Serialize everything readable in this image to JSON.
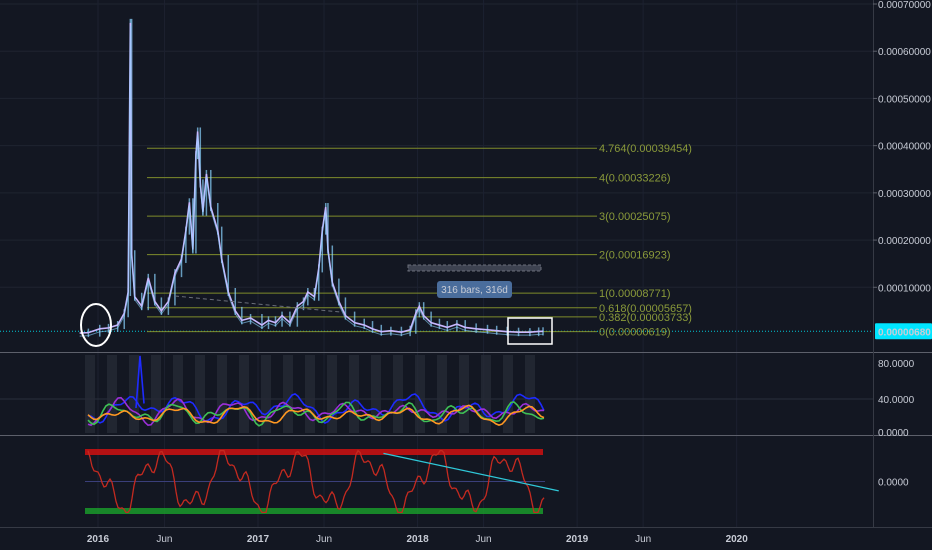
{
  "chart_data": [
    {
      "type": "line",
      "title": "",
      "price_axis": {
        "ticks": [
          "0.00070000",
          "0.00060000",
          "0.00050000",
          "0.00040000",
          "0.00030000",
          "0.00020000",
          "0.00010000"
        ],
        "tick_values": [
          0.0007,
          0.0006,
          0.0005,
          0.0004,
          0.0003,
          0.0002,
          0.0001
        ],
        "ylim": [
          0,
          0.0007
        ],
        "current_price_label": "0.00000680",
        "current_price": 6.8e-06
      },
      "x_ticks": [
        {
          "label": "2016",
          "date": "2016-01-01",
          "bold": true
        },
        {
          "label": "Jun",
          "date": "2016-06-01",
          "bold": false
        },
        {
          "label": "2017",
          "date": "2017-01-01",
          "bold": true
        },
        {
          "label": "Jun",
          "date": "2017-06-01",
          "bold": false
        },
        {
          "label": "2018",
          "date": "2018-01-01",
          "bold": true
        },
        {
          "label": "Jun",
          "date": "2018-06-01",
          "bold": false
        },
        {
          "label": "2019",
          "date": "2019-01-01",
          "bold": true
        },
        {
          "label": "Jun",
          "date": "2019-06-01",
          "bold": false
        },
        {
          "label": "2020",
          "date": "2020-01-01",
          "bold": true
        }
      ],
      "price_series": [
        [
          "2015-11-20",
          3e-06
        ],
        [
          "2015-12-10",
          4e-06
        ],
        [
          "2016-01-05",
          1.2e-05
        ],
        [
          "2016-01-25",
          1.4e-05
        ],
        [
          "2016-02-15",
          2e-05
        ],
        [
          "2016-03-01",
          4.5e-05
        ],
        [
          "2016-03-10",
          9e-05
        ],
        [
          "2016-03-15",
          0.00066
        ],
        [
          "2016-03-18",
          0.00017
        ],
        [
          "2016-03-25",
          8e-05
        ],
        [
          "2016-04-10",
          6e-05
        ],
        [
          "2016-04-25",
          0.00012
        ],
        [
          "2016-05-10",
          7e-05
        ],
        [
          "2016-05-25",
          5e-05
        ],
        [
          "2016-06-10",
          7e-05
        ],
        [
          "2016-06-25",
          0.00013
        ],
        [
          "2016-07-10",
          0.00016
        ],
        [
          "2016-07-20",
          0.00022
        ],
        [
          "2016-07-28",
          0.00028
        ],
        [
          "2016-08-05",
          0.00018
        ],
        [
          "2016-08-12",
          0.00038
        ],
        [
          "2016-08-16",
          0.00043
        ],
        [
          "2016-08-22",
          0.00032
        ],
        [
          "2016-08-28",
          0.00026
        ],
        [
          "2016-09-05",
          0.00034
        ],
        [
          "2016-09-15",
          0.00027
        ],
        [
          "2016-10-01",
          0.00022
        ],
        [
          "2016-10-10",
          0.00016
        ],
        [
          "2016-10-25",
          9e-05
        ],
        [
          "2016-11-10",
          5e-05
        ],
        [
          "2016-11-25",
          3e-05
        ],
        [
          "2016-12-15",
          3.5e-05
        ],
        [
          "2017-01-10",
          2e-05
        ],
        [
          "2017-01-25",
          3e-05
        ],
        [
          "2017-02-10",
          2.5e-05
        ],
        [
          "2017-02-25",
          4e-05
        ],
        [
          "2017-03-15",
          2.5e-05
        ],
        [
          "2017-04-01",
          6e-05
        ],
        [
          "2017-04-15",
          7e-05
        ],
        [
          "2017-04-25",
          9e-05
        ],
        [
          "2017-05-10",
          8e-05
        ],
        [
          "2017-05-20",
          0.00014
        ],
        [
          "2017-05-28",
          0.00022
        ],
        [
          "2017-06-05",
          0.00027
        ],
        [
          "2017-06-10",
          0.00018
        ],
        [
          "2017-06-20",
          0.00011
        ],
        [
          "2017-07-05",
          7e-05
        ],
        [
          "2017-07-20",
          4e-05
        ],
        [
          "2017-08-10",
          2.5e-05
        ],
        [
          "2017-09-01",
          2e-05
        ],
        [
          "2017-09-20",
          1.2e-05
        ],
        [
          "2017-10-10",
          6e-06
        ],
        [
          "2017-11-01",
          8e-06
        ],
        [
          "2017-11-25",
          5e-06
        ],
        [
          "2017-12-15",
          1e-05
        ],
        [
          "2017-12-28",
          4.5e-05
        ],
        [
          "2018-01-05",
          6e-05
        ],
        [
          "2018-01-15",
          4e-05
        ],
        [
          "2018-02-01",
          2.5e-05
        ],
        [
          "2018-02-20",
          2e-05
        ],
        [
          "2018-03-10",
          1.5e-05
        ],
        [
          "2018-04-01",
          2.2e-05
        ],
        [
          "2018-04-20",
          1.5e-05
        ],
        [
          "2018-05-15",
          1.2e-05
        ],
        [
          "2018-06-10",
          1e-05
        ],
        [
          "2018-07-01",
          8e-06
        ],
        [
          "2018-07-25",
          6e-06
        ],
        [
          "2018-08-20",
          5e-06
        ],
        [
          "2018-09-15",
          5e-06
        ],
        [
          "2018-10-05",
          6.5e-06
        ],
        [
          "2018-10-15",
          6.8e-06
        ]
      ],
      "fib_levels": [
        {
          "label": "4.764(0.00039454)",
          "value": 0.00039454
        },
        {
          "label": "4(0.00033226)",
          "value": 0.00033226
        },
        {
          "label": "3(0.00025075)",
          "value": 0.00025075
        },
        {
          "label": "2(0.00016923)",
          "value": 0.00016923
        },
        {
          "label": "1(0.00008771)",
          "value": 8.771e-05
        },
        {
          "label": "0.618(0.00005657)",
          "value": 5.657e-05
        },
        {
          "label": "0.382(0.00003733)",
          "value": 3.733e-05
        },
        {
          "label": "0(0.00000619)",
          "value": 6.19e-06
        }
      ],
      "measure_label": "316 bars, 316d"
    },
    {
      "type": "line",
      "title": "",
      "y_ticks": [
        "80.0000",
        "40.0000",
        "0.0000"
      ],
      "tick_values": [
        80,
        40,
        0
      ],
      "ylim": [
        0,
        90
      ],
      "series_colors": [
        "#1e2bff",
        "#9b2fd8",
        "#3fbf55",
        "#ff9822"
      ]
    },
    {
      "type": "line",
      "title": "",
      "y_ticks": [
        "0.0000"
      ],
      "tick_values": [
        0
      ],
      "ylim": [
        -1.3,
        1.3
      ],
      "bands": [
        {
          "value": 1.1,
          "color": "#d01010"
        },
        {
          "value": -1.1,
          "color": "#1a9a2a"
        }
      ],
      "trendline": [
        [
          "2017-10-15",
          1.05
        ],
        [
          "2018-11-20",
          -0.35
        ]
      ],
      "series_color": "#c42a20"
    }
  ],
  "colors": {
    "background": "#131722",
    "price_line": "#c9b8ff",
    "price_candles": "#8ad4ff",
    "fib_line": "#7f8c2b",
    "current_price_line": "#00c8d8",
    "current_price_box": "#00e5ff",
    "measure_box": "#4a6d9c",
    "annotation": "#ffffff"
  },
  "icons": [
    "white-circle-annotation",
    "white-rectangle-annotation"
  ]
}
